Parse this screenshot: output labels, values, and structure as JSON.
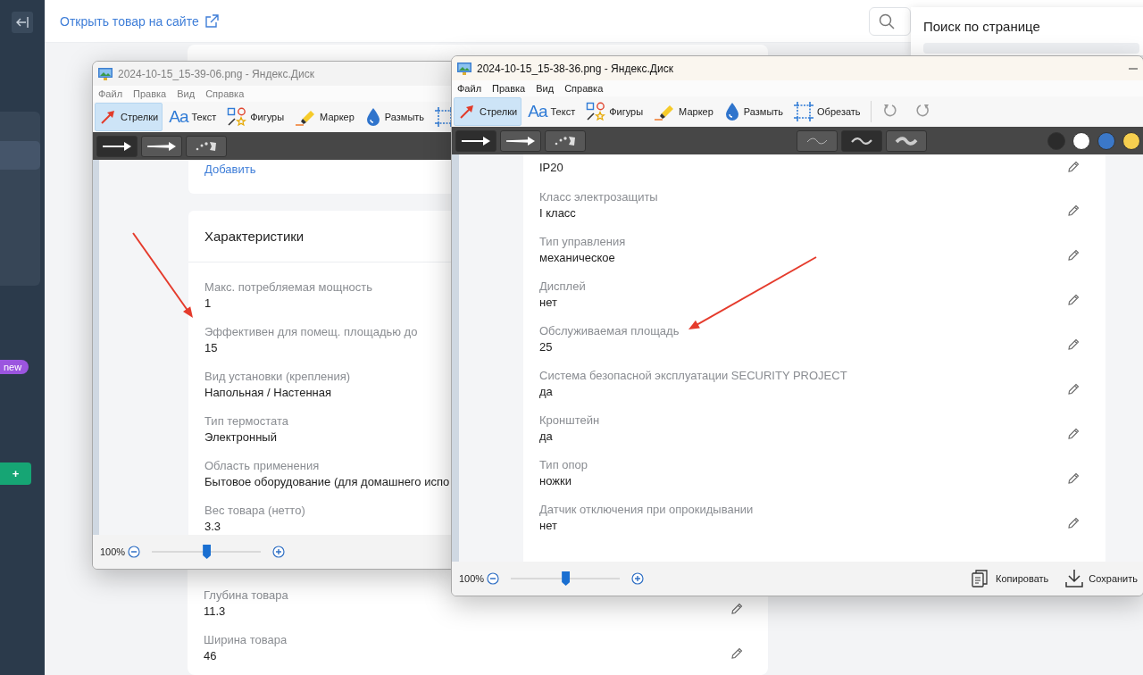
{
  "sidebar": {
    "badge": "new",
    "add_label": "+"
  },
  "header": {
    "link": "Открыть товар на сайте"
  },
  "page_search": {
    "title": "Поиск по странице"
  },
  "page": {
    "editable": true,
    "fields": [
      {
        "label": "Глубина товара",
        "value": "11.3"
      },
      {
        "label": "Ширина товара",
        "value": "46"
      }
    ]
  },
  "windows": [
    {
      "title": "2024-10-15_15-39-06.png - Яндекс.Диск",
      "active": false,
      "menu": [
        "Файл",
        "Правка",
        "Вид",
        "Справка"
      ],
      "tools": [
        {
          "kind": "arrow",
          "label": "Стрелки",
          "selected": true
        },
        {
          "kind": "text",
          "glyph": "Aa",
          "label": "Текст",
          "selected": false
        },
        {
          "kind": "shapes",
          "label": "Фигуры",
          "selected": false
        },
        {
          "kind": "marker",
          "label": "Маркер",
          "selected": false
        },
        {
          "kind": "blur",
          "label": "Размыть",
          "selected": false
        },
        {
          "kind": "crop",
          "selected": false
        }
      ],
      "arrow_styles": [
        {
          "kind": "plain",
          "selected": true
        },
        {
          "kind": "bold",
          "selected": false
        },
        {
          "kind": "dots",
          "selected": false
        }
      ],
      "content": {
        "link": "Добавить",
        "card_title": "Характеристики",
        "fields": [
          {
            "label": "Макс. потребляемая мощность",
            "value": "1"
          },
          {
            "label": "Эффективен для помещ. площадью до",
            "value": "15"
          },
          {
            "label": "Вид установки (крепления)",
            "value": "Напольная / Настенная"
          },
          {
            "label": "Тип термостата",
            "value": "Электронный"
          },
          {
            "label": "Область применения",
            "value": "Бытовое оборудование (для домашнего испо"
          },
          {
            "label": "Вес товара (нетто)",
            "value": "3.3"
          }
        ]
      },
      "zoom": {
        "reading": "100%",
        "level": 0.5
      }
    },
    {
      "title": "2024-10-15_15-38-36.png - Яндекс.Диск",
      "active": true,
      "menu": [
        "Файл",
        "Правка",
        "Вид",
        "Справка"
      ],
      "tools": [
        {
          "kind": "arrow",
          "label": "Стрелки",
          "selected": true
        },
        {
          "kind": "text",
          "glyph": "Aa",
          "label": "Текст",
          "selected": false
        },
        {
          "kind": "shapes",
          "label": "Фигуры",
          "selected": false
        },
        {
          "kind": "marker",
          "label": "Маркер",
          "selected": false
        },
        {
          "kind": "blur",
          "label": "Размыть",
          "selected": false
        },
        {
          "kind": "crop",
          "label": "Обрезать",
          "selected": false
        }
      ],
      "history": [
        {
          "kind": "undo"
        },
        {
          "kind": "redo"
        }
      ],
      "arrow_styles": [
        {
          "kind": "plain",
          "selected": true
        },
        {
          "kind": "bold",
          "selected": false
        },
        {
          "kind": "dots",
          "selected": false
        }
      ],
      "stroke_widths": [
        {
          "kind": "thin",
          "selected": false
        },
        {
          "kind": "medium",
          "selected": true
        },
        {
          "kind": "thick",
          "selected": false
        }
      ],
      "colors": [
        {
          "color": "#2b2b2b"
        },
        {
          "color": "#ffffff"
        },
        {
          "color": "#3b78c8"
        },
        {
          "color": "#f6cf4f"
        }
      ],
      "content": {
        "editable": true,
        "fields": [
          {
            "value": "IP20"
          },
          {
            "label": "Класс электрозащиты",
            "value": "I класс"
          },
          {
            "label": "Тип управления",
            "value": "механическое"
          },
          {
            "label": "Дисплей",
            "value": "нет"
          },
          {
            "label": "Обслуживаемая площадь",
            "value": "25"
          },
          {
            "label": "Система безопасной эксплуатации SECURITY PROJECT",
            "value": "да"
          },
          {
            "label": "Кронштейн",
            "value": "да"
          },
          {
            "label": "Тип опор",
            "value": "ножки"
          },
          {
            "label": "Датчик отключения при опрокидывании",
            "value": "нет"
          }
        ]
      },
      "zoom": {
        "reading": "100%",
        "level": 0.5
      },
      "actions": [
        {
          "kind": "copy",
          "label": "Копировать"
        },
        {
          "kind": "save",
          "label": "Сохранить"
        }
      ]
    }
  ]
}
